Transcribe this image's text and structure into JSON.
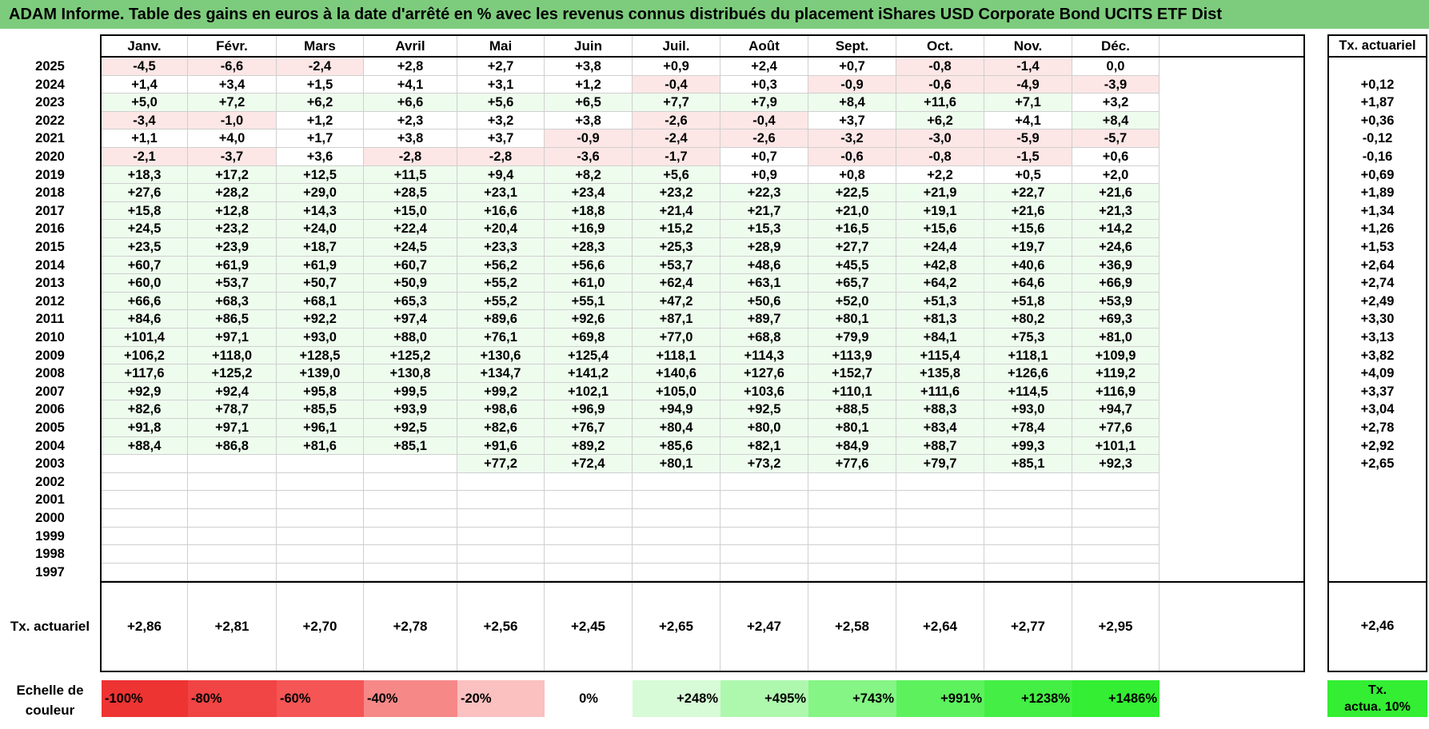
{
  "title": "ADAM Informe. Table des gains en euros à la date d'arrêté en % avec les revenus connus distribués du placement iShares USD Corporate Bond UCITS ETF Dist",
  "months": [
    "Janv.",
    "Févr.",
    "Mars",
    "Avril",
    "Mai",
    "Juin",
    "Juil.",
    "Août",
    "Sept.",
    "Oct.",
    "Nov.",
    "Déc."
  ],
  "side_header": "Tx. actuariel",
  "rows": [
    {
      "year": "2025",
      "values": [
        "-4,5",
        "-6,6",
        "-2,4",
        "+2,8",
        "+2,7",
        "+3,8",
        "+0,9",
        "+2,4",
        "+0,7",
        "-0,8",
        "-1,4",
        "0,0"
      ],
      "rate": ""
    },
    {
      "year": "2024",
      "values": [
        "+1,4",
        "+3,4",
        "+1,5",
        "+4,1",
        "+3,1",
        "+1,2",
        "-0,4",
        "+0,3",
        "-0,9",
        "-0,6",
        "-4,9",
        "-3,9"
      ],
      "rate": "+0,12"
    },
    {
      "year": "2023",
      "values": [
        "+5,0",
        "+7,2",
        "+6,2",
        "+6,6",
        "+5,6",
        "+6,5",
        "+7,7",
        "+7,9",
        "+8,4",
        "+11,6",
        "+7,1",
        "+3,2"
      ],
      "rate": "+1,87"
    },
    {
      "year": "2022",
      "values": [
        "-3,4",
        "-1,0",
        "+1,2",
        "+2,3",
        "+3,2",
        "+3,8",
        "-2,6",
        "-0,4",
        "+3,7",
        "+6,2",
        "+4,1",
        "+8,4"
      ],
      "rate": "+0,36"
    },
    {
      "year": "2021",
      "values": [
        "+1,1",
        "+4,0",
        "+1,7",
        "+3,8",
        "+3,7",
        "-0,9",
        "-2,4",
        "-2,6",
        "-3,2",
        "-3,0",
        "-5,9",
        "-5,7"
      ],
      "rate": "-0,12"
    },
    {
      "year": "2020",
      "values": [
        "-2,1",
        "-3,7",
        "+3,6",
        "-2,8",
        "-2,8",
        "-3,6",
        "-1,7",
        "+0,7",
        "-0,6",
        "-0,8",
        "-1,5",
        "+0,6"
      ],
      "rate": "-0,16"
    },
    {
      "year": "2019",
      "values": [
        "+18,3",
        "+17,2",
        "+12,5",
        "+11,5",
        "+9,4",
        "+8,2",
        "+5,6",
        "+0,9",
        "+0,8",
        "+2,2",
        "+0,5",
        "+2,0"
      ],
      "rate": "+0,69"
    },
    {
      "year": "2018",
      "values": [
        "+27,6",
        "+28,2",
        "+29,0",
        "+28,5",
        "+23,1",
        "+23,4",
        "+23,2",
        "+22,3",
        "+22,5",
        "+21,9",
        "+22,7",
        "+21,6"
      ],
      "rate": "+1,89"
    },
    {
      "year": "2017",
      "values": [
        "+15,8",
        "+12,8",
        "+14,3",
        "+15,0",
        "+16,6",
        "+18,8",
        "+21,4",
        "+21,7",
        "+21,0",
        "+19,1",
        "+21,6",
        "+21,3"
      ],
      "rate": "+1,34"
    },
    {
      "year": "2016",
      "values": [
        "+24,5",
        "+23,2",
        "+24,0",
        "+22,4",
        "+20,4",
        "+16,9",
        "+15,2",
        "+15,3",
        "+16,5",
        "+15,6",
        "+15,6",
        "+14,2"
      ],
      "rate": "+1,26"
    },
    {
      "year": "2015",
      "values": [
        "+23,5",
        "+23,9",
        "+18,7",
        "+24,5",
        "+23,3",
        "+28,3",
        "+25,3",
        "+28,9",
        "+27,7",
        "+24,4",
        "+19,7",
        "+24,6"
      ],
      "rate": "+1,53"
    },
    {
      "year": "2014",
      "values": [
        "+60,7",
        "+61,9",
        "+61,9",
        "+60,7",
        "+56,2",
        "+56,6",
        "+53,7",
        "+48,6",
        "+45,5",
        "+42,8",
        "+40,6",
        "+36,9"
      ],
      "rate": "+2,64"
    },
    {
      "year": "2013",
      "values": [
        "+60,0",
        "+53,7",
        "+50,7",
        "+50,9",
        "+55,2",
        "+61,0",
        "+62,4",
        "+63,1",
        "+65,7",
        "+64,2",
        "+64,6",
        "+66,9"
      ],
      "rate": "+2,74"
    },
    {
      "year": "2012",
      "values": [
        "+66,6",
        "+68,3",
        "+68,1",
        "+65,3",
        "+55,2",
        "+55,1",
        "+47,2",
        "+50,6",
        "+52,0",
        "+51,3",
        "+51,8",
        "+53,9"
      ],
      "rate": "+2,49"
    },
    {
      "year": "2011",
      "values": [
        "+84,6",
        "+86,5",
        "+92,2",
        "+97,4",
        "+89,6",
        "+92,6",
        "+87,1",
        "+89,7",
        "+80,1",
        "+81,3",
        "+80,2",
        "+69,3"
      ],
      "rate": "+3,30"
    },
    {
      "year": "2010",
      "values": [
        "+101,4",
        "+97,1",
        "+93,0",
        "+88,0",
        "+76,1",
        "+69,8",
        "+77,0",
        "+68,8",
        "+79,9",
        "+84,1",
        "+75,3",
        "+81,0"
      ],
      "rate": "+3,13"
    },
    {
      "year": "2009",
      "values": [
        "+106,2",
        "+118,0",
        "+128,5",
        "+125,2",
        "+130,6",
        "+125,4",
        "+118,1",
        "+114,3",
        "+113,9",
        "+115,4",
        "+118,1",
        "+109,9"
      ],
      "rate": "+3,82"
    },
    {
      "year": "2008",
      "values": [
        "+117,6",
        "+125,2",
        "+139,0",
        "+130,8",
        "+134,7",
        "+141,2",
        "+140,6",
        "+127,6",
        "+152,7",
        "+135,8",
        "+126,6",
        "+119,2"
      ],
      "rate": "+4,09"
    },
    {
      "year": "2007",
      "values": [
        "+92,9",
        "+92,4",
        "+95,8",
        "+99,5",
        "+99,2",
        "+102,1",
        "+105,0",
        "+103,6",
        "+110,1",
        "+111,6",
        "+114,5",
        "+116,9"
      ],
      "rate": "+3,37"
    },
    {
      "year": "2006",
      "values": [
        "+82,6",
        "+78,7",
        "+85,5",
        "+93,9",
        "+98,6",
        "+96,9",
        "+94,9",
        "+92,5",
        "+88,5",
        "+88,3",
        "+93,0",
        "+94,7"
      ],
      "rate": "+3,04"
    },
    {
      "year": "2005",
      "values": [
        "+91,8",
        "+97,1",
        "+96,1",
        "+92,5",
        "+82,6",
        "+76,7",
        "+80,4",
        "+80,0",
        "+80,1",
        "+83,4",
        "+78,4",
        "+77,6"
      ],
      "rate": "+2,78"
    },
    {
      "year": "2004",
      "values": [
        "+88,4",
        "+86,8",
        "+81,6",
        "+85,1",
        "+91,6",
        "+89,2",
        "+85,6",
        "+82,1",
        "+84,9",
        "+88,7",
        "+99,3",
        "+101,1"
      ],
      "rate": "+2,92"
    },
    {
      "year": "2003",
      "values": [
        "",
        "",
        "",
        "",
        "+77,2",
        "+72,4",
        "+80,1",
        "+73,2",
        "+77,6",
        "+79,7",
        "+85,1",
        "+92,3"
      ],
      "rate": "+2,65"
    },
    {
      "year": "2002",
      "values": [
        "",
        "",
        "",
        "",
        "",
        "",
        "",
        "",
        "",
        "",
        "",
        ""
      ],
      "rate": ""
    },
    {
      "year": "2001",
      "values": [
        "",
        "",
        "",
        "",
        "",
        "",
        "",
        "",
        "",
        "",
        "",
        ""
      ],
      "rate": ""
    },
    {
      "year": "2000",
      "values": [
        "",
        "",
        "",
        "",
        "",
        "",
        "",
        "",
        "",
        "",
        "",
        ""
      ],
      "rate": ""
    },
    {
      "year": "1999",
      "values": [
        "",
        "",
        "",
        "",
        "",
        "",
        "",
        "",
        "",
        "",
        "",
        ""
      ],
      "rate": ""
    },
    {
      "year": "1998",
      "values": [
        "",
        "",
        "",
        "",
        "",
        "",
        "",
        "",
        "",
        "",
        "",
        ""
      ],
      "rate": ""
    },
    {
      "year": "1997",
      "values": [
        "",
        "",
        "",
        "",
        "",
        "",
        "",
        "",
        "",
        "",
        "",
        ""
      ],
      "rate": ""
    }
  ],
  "footer": {
    "label": "Tx. actuariel",
    "values": [
      "+2,86",
      "+2,81",
      "+2,70",
      "+2,78",
      "+2,56",
      "+2,45",
      "+2,65",
      "+2,47",
      "+2,58",
      "+2,64",
      "+2,77",
      "+2,95"
    ],
    "total": "+2,46"
  },
  "scale": {
    "label_line1": "Echelle de",
    "label_line2": "couleur",
    "items": [
      {
        "label": "-100%",
        "color": "#ee3333"
      },
      {
        "label": "-80%",
        "color": "#f14444"
      },
      {
        "label": "-60%",
        "color": "#f55555"
      },
      {
        "label": "-40%",
        "color": "#f78888"
      },
      {
        "label": "-20%",
        "color": "#fbc0c0"
      },
      {
        "label": "0%",
        "color": "#ffffff"
      },
      {
        "label": "+248%",
        "color": "#d6fbd6"
      },
      {
        "label": "+495%",
        "color": "#aef8ae"
      },
      {
        "label": "+743%",
        "color": "#85f585"
      },
      {
        "label": "+991%",
        "color": "#5df25d"
      },
      {
        "label": "+1238%",
        "color": "#44ee44"
      },
      {
        "label": "+1486%",
        "color": "#33ee33"
      }
    ],
    "side_line1": "Tx.",
    "side_line2": "actua. 10%",
    "side_color": "#33ee33"
  },
  "colors": {
    "title_bg": "#7dcc7d",
    "negative_tint": "#fde6e6",
    "positive_tint": "#eefcee"
  }
}
